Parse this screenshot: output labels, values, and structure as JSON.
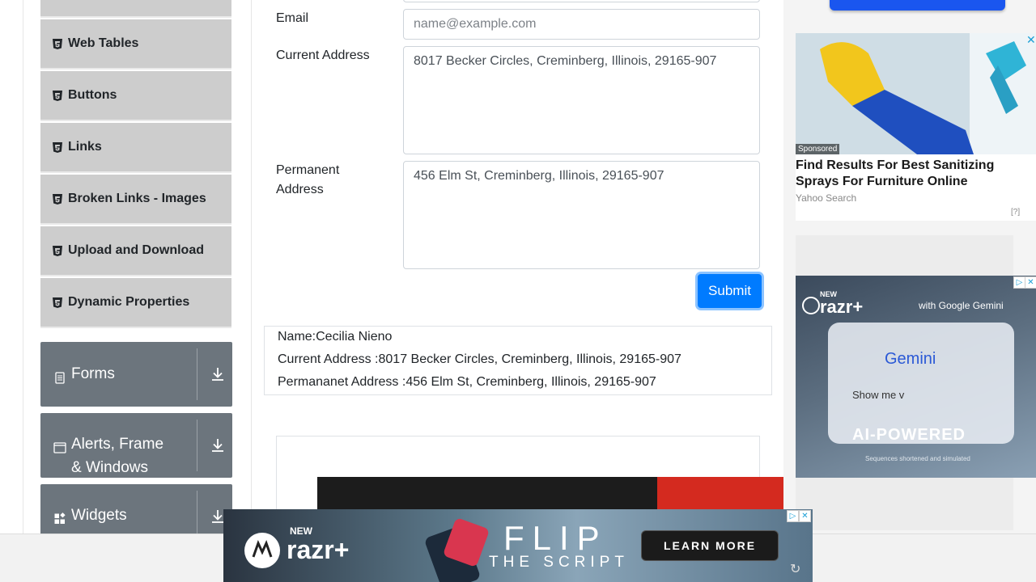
{
  "sidebar": {
    "items": [
      {
        "label": "Web Tables"
      },
      {
        "label": "Buttons"
      },
      {
        "label": "Links"
      },
      {
        "label": "Broken Links - Images"
      },
      {
        "label": "Upload and Download"
      },
      {
        "label": "Dynamic Properties"
      }
    ],
    "groups": [
      {
        "label": "Forms",
        "icon": "document-icon"
      },
      {
        "label": "Alerts, Frame & Windows",
        "icon": "window-icon"
      },
      {
        "label": "Widgets",
        "icon": "widgets-icon"
      }
    ]
  },
  "form": {
    "email_label": "Email",
    "email_placeholder": "name@example.com",
    "current_address_label": "Current Address",
    "current_address_value": "8017 Becker Circles, Creminberg, Illinois, 29165-907",
    "permanent_address_label_1": "Permanent",
    "permanent_address_label_2": "Address",
    "permanent_address_value": "456 Elm St, Creminberg, Illinois, 29165-907",
    "submit_label": "Submit"
  },
  "output": {
    "name": "Name:Cecilia Nieno",
    "current_address": "Current Address :8017 Becker Circles, Creminberg, Illinois, 29165-907",
    "permanent_address": "Permananet Address :456 Elm St, Creminberg, Illinois, 29165-907"
  },
  "ads": {
    "sponsored_ad": {
      "badge": "Sponsored",
      "title": "Find Results For Best Sanitizing Sprays For Furniture Online",
      "source": "Yahoo Search",
      "info": "[?]"
    },
    "razr_ad": {
      "new_label": "NEW",
      "brand": "razr+",
      "tagline": "with Google Gemini",
      "gemini": "Gemini",
      "prompt": "Show me v",
      "headline": "AI-POWERED",
      "footnote": "Sequences shortened and simulated"
    },
    "banner": {
      "new_label": "NEW",
      "brand": "razr+",
      "headline": "FLIP",
      "subline": "THE SCRIPT",
      "cta": "LEARN MORE"
    }
  },
  "colors": {
    "accent": "#007bff",
    "sidebar_item_bg": "#cdcdcd",
    "group_bg": "#6c757d"
  }
}
